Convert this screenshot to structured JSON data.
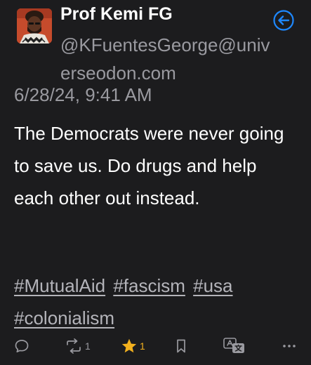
{
  "post": {
    "author": {
      "display_name": "Prof Kemi FG",
      "handle": "@KFuentesGeorge@universeodon.com",
      "avatar_icon": "avatar-photo-icon"
    },
    "timestamp": "6/28/24, 9:41 AM",
    "body": "The Democrats were never going to save us. Do drugs and help each other out instead.",
    "hashtags": [
      "#MutualAid",
      "#fascism",
      "#usa",
      "#colonialism"
    ],
    "actions": {
      "reply": {
        "icon": "reply-icon"
      },
      "boost": {
        "icon": "boost-icon",
        "count": "1"
      },
      "favorite": {
        "icon": "star-icon",
        "count": "1"
      },
      "bookmark": {
        "icon": "bookmark-icon"
      },
      "translate": {
        "icon": "translate-icon"
      },
      "more": {
        "icon": "more-icon"
      }
    }
  },
  "nav": {
    "back_icon": "back-arrow-icon"
  },
  "colors": {
    "background": "#1c1c1e",
    "text": "#ffffff",
    "muted": "#9a9aa0",
    "accent": "#1e88ff",
    "star": "#f2b01e"
  }
}
